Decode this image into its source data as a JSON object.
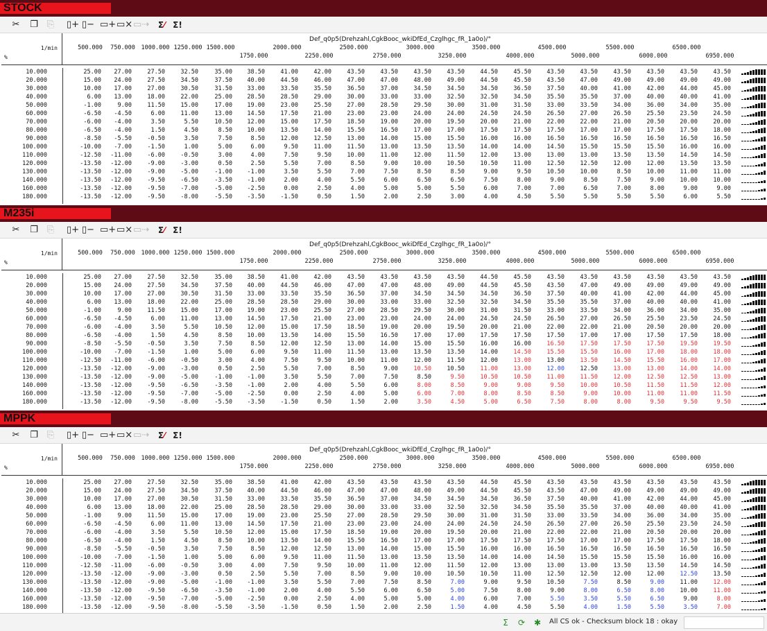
{
  "panels": [
    {
      "title": "STOCK",
      "mode": "base"
    },
    {
      "title": "M235i",
      "mode": "m235"
    },
    {
      "title": "MPPK",
      "mode": "mppk"
    }
  ],
  "toolbar": {
    "icons": [
      "cut-icon",
      "copy-icon",
      "paste-icon",
      "add-column-icon",
      "remove-column-icon",
      "add-row-icon",
      "remove-row-icon",
      "fill-icon",
      "checksum-error-icon",
      "checksum-icon"
    ],
    "sigma_label": "Σ"
  },
  "table": {
    "axis_name": "Def_q0p5(Drehzahl,CgkBooc_wkiDfEd_Czglhgc_fR_1a0o)/°",
    "row_unit": "1/min",
    "row_axis_label": "%",
    "columns": [
      "500.000",
      "750.000",
      "1000.000",
      "1250.000",
      "1500.000",
      "1750.000",
      "2000.000",
      "2250.000",
      "2500.000",
      "2750.000",
      "3000.000",
      "3250.000",
      "3500.000",
      "4000.000",
      "4500.000",
      "5000.000",
      "5500.000",
      "6000.000",
      "6500.000",
      "6950.000"
    ],
    "rows": [
      "10.000",
      "20.000",
      "30.000",
      "40.000",
      "50.000",
      "60.000",
      "70.000",
      "80.000",
      "90.000",
      "100.000",
      "110.000",
      "120.000",
      "130.000",
      "140.000",
      "160.000",
      "180.000"
    ],
    "stock": [
      [
        "25.00",
        "27.00",
        "27.50",
        "32.50",
        "35.00",
        "38.50",
        "41.00",
        "42.00",
        "43.50",
        "43.50",
        "43.50",
        "43.50",
        "44.50",
        "45.50",
        "43.50",
        "43.50",
        "43.50",
        "43.50",
        "43.50",
        "43.50"
      ],
      [
        "15.00",
        "24.00",
        "27.50",
        "34.50",
        "37.50",
        "40.00",
        "44.50",
        "46.00",
        "47.00",
        "47.00",
        "48.00",
        "49.00",
        "44.50",
        "45.50",
        "43.50",
        "47.00",
        "49.00",
        "49.00",
        "49.00",
        "49.00"
      ],
      [
        "10.00",
        "17.00",
        "27.00",
        "30.50",
        "31.50",
        "33.00",
        "33.50",
        "35.50",
        "36.50",
        "37.00",
        "34.50",
        "34.50",
        "34.50",
        "36.50",
        "37.50",
        "40.00",
        "41.00",
        "42.00",
        "44.00",
        "45.00"
      ],
      [
        "6.00",
        "13.00",
        "18.00",
        "22.00",
        "25.00",
        "28.50",
        "28.50",
        "29.00",
        "30.00",
        "33.00",
        "33.00",
        "32.50",
        "32.50",
        "34.50",
        "35.50",
        "35.50",
        "37.00",
        "40.00",
        "40.00",
        "41.00"
      ],
      [
        "-1.00",
        "9.00",
        "11.50",
        "15.00",
        "17.00",
        "19.00",
        "23.00",
        "25.50",
        "27.00",
        "28.50",
        "29.50",
        "30.00",
        "31.00",
        "31.50",
        "33.00",
        "33.50",
        "34.00",
        "36.00",
        "34.00",
        "35.00"
      ],
      [
        "-6.50",
        "-4.50",
        "6.00",
        "11.00",
        "13.00",
        "14.50",
        "17.50",
        "21.00",
        "23.00",
        "23.00",
        "24.00",
        "24.00",
        "24.50",
        "24.50",
        "26.50",
        "27.00",
        "26.50",
        "25.50",
        "23.50",
        "24.50"
      ],
      [
        "-6.00",
        "-4.00",
        "3.50",
        "5.50",
        "10.50",
        "12.00",
        "15.00",
        "17.50",
        "18.50",
        "19.00",
        "20.00",
        "19.50",
        "20.00",
        "21.00",
        "22.00",
        "22.00",
        "21.00",
        "20.50",
        "20.00",
        "20.00"
      ],
      [
        "-6.50",
        "-4.00",
        "1.50",
        "4.50",
        "8.50",
        "10.00",
        "13.50",
        "14.00",
        "15.50",
        "16.50",
        "17.00",
        "17.00",
        "17.50",
        "17.50",
        "17.50",
        "17.00",
        "17.00",
        "17.50",
        "17.50",
        "18.00"
      ],
      [
        "-8.50",
        "-5.50",
        "-0.50",
        "3.50",
        "7.50",
        "8.50",
        "12.00",
        "12.50",
        "13.00",
        "14.00",
        "15.00",
        "15.50",
        "16.00",
        "16.00",
        "16.50",
        "16.50",
        "16.50",
        "16.50",
        "16.50",
        "16.50"
      ],
      [
        "-10.00",
        "-7.00",
        "-1.50",
        "1.00",
        "5.00",
        "6.00",
        "9.50",
        "11.00",
        "11.50",
        "13.00",
        "13.50",
        "13.50",
        "14.00",
        "14.00",
        "14.50",
        "15.50",
        "15.50",
        "15.50",
        "16.00",
        "16.00"
      ],
      [
        "-12.50",
        "-11.00",
        "-6.00",
        "-0.50",
        "3.00",
        "4.00",
        "7.50",
        "9.50",
        "10.00",
        "11.00",
        "12.00",
        "11.50",
        "12.00",
        "13.00",
        "13.00",
        "13.00",
        "13.50",
        "13.50",
        "14.50",
        "14.50"
      ],
      [
        "-13.50",
        "-12.00",
        "-9.00",
        "-3.00",
        "0.50",
        "2.50",
        "5.50",
        "7.00",
        "8.50",
        "9.00",
        "10.00",
        "10.50",
        "10.50",
        "11.00",
        "12.50",
        "12.50",
        "12.00",
        "12.00",
        "13.50",
        "13.50"
      ],
      [
        "-13.50",
        "-12.00",
        "-9.00",
        "-5.00",
        "-1.00",
        "-1.00",
        "3.50",
        "5.50",
        "7.00",
        "7.50",
        "8.50",
        "8.50",
        "9.00",
        "9.50",
        "10.50",
        "10.00",
        "8.50",
        "10.00",
        "11.00",
        "11.00"
      ],
      [
        "-13.50",
        "-12.00",
        "-9.50",
        "-6.50",
        "-3.50",
        "-1.00",
        "2.00",
        "4.00",
        "5.50",
        "6.00",
        "6.50",
        "6.50",
        "7.50",
        "8.00",
        "9.00",
        "8.50",
        "7.50",
        "9.00",
        "10.00",
        "10.00"
      ],
      [
        "-13.50",
        "-12.00",
        "-9.50",
        "-7.00",
        "-5.00",
        "-2.50",
        "0.00",
        "2.50",
        "4.00",
        "5.00",
        "5.00",
        "5.50",
        "6.00",
        "7.00",
        "7.00",
        "6.50",
        "7.00",
        "8.00",
        "9.00",
        "9.00"
      ],
      [
        "-13.50",
        "-12.00",
        "-9.50",
        "-8.00",
        "-5.50",
        "-3.50",
        "-1.50",
        "0.50",
        "1.50",
        "2.00",
        "2.50",
        "3.00",
        "4.00",
        "4.50",
        "5.50",
        "5.50",
        "5.50",
        "5.50",
        "6.00",
        "5.50"
      ]
    ],
    "m235_mods": {
      "8": {
        "14": [
          "16.50",
          "r"
        ],
        "15": [
          "17.50",
          "r"
        ],
        "16": [
          "17.50",
          "r"
        ],
        "17": [
          "17.50",
          "r"
        ],
        "18": [
          "19.50",
          "r"
        ],
        "19": [
          "19.50",
          "r"
        ]
      },
      "9": {
        "13": [
          "14.50",
          "r"
        ],
        "14": [
          "15.50",
          "r"
        ],
        "15": [
          "15.50",
          "r"
        ],
        "16": [
          "16.00",
          "r"
        ],
        "17": [
          "17.00",
          "r"
        ],
        "18": [
          "18.00",
          "r"
        ],
        "19": [
          "18.00",
          "r"
        ]
      },
      "10": {
        "13": [
          "13.00",
          "r"
        ],
        "14": [
          "13.00",
          ""
        ],
        "15": [
          "13.50",
          "r"
        ],
        "16": [
          "14.50",
          "r"
        ],
        "17": [
          "15.50",
          "r"
        ],
        "18": [
          "16.00",
          "r"
        ],
        "19": [
          "17.00",
          "r"
        ]
      },
      "11": {
        "10": [
          "10.50",
          "r"
        ],
        "11": [
          "10.50",
          ""
        ],
        "12": [
          "11.00",
          "r"
        ],
        "13": [
          "13.00",
          "r"
        ],
        "14": [
          "12.00",
          "b"
        ],
        "15": [
          "12.50",
          ""
        ],
        "16": [
          "13.00",
          "r"
        ],
        "17": [
          "13.00",
          "r"
        ],
        "18": [
          "14.00",
          "r"
        ],
        "19": [
          "14.00",
          "r"
        ]
      },
      "12": {
        "11": [
          "9.50",
          "r"
        ],
        "12": [
          "10.50",
          "r"
        ],
        "13": [
          "10.50",
          "r"
        ],
        "14": [
          "11.00",
          "r"
        ],
        "15": [
          "11.50",
          "r"
        ],
        "16": [
          "12.00",
          "r"
        ],
        "17": [
          "12.50",
          "r"
        ],
        "18": [
          "12.50",
          "r"
        ],
        "19": [
          "13.00",
          "r"
        ]
      },
      "13": {
        "10": [
          "8.00",
          "r"
        ],
        "11": [
          "8.50",
          "r"
        ],
        "12": [
          "9.00",
          "r"
        ],
        "13": [
          "9.00",
          "r"
        ],
        "14": [
          "9.50",
          "r"
        ],
        "15": [
          "10.00",
          "r"
        ],
        "16": [
          "10.50",
          "r"
        ],
        "17": [
          "11.50",
          "r"
        ],
        "18": [
          "11.50",
          "r"
        ],
        "19": [
          "12.00",
          "r"
        ]
      },
      "14": {
        "10": [
          "6.00",
          "r"
        ],
        "11": [
          "7.00",
          "r"
        ],
        "12": [
          "8.00",
          "r"
        ],
        "13": [
          "8.50",
          "r"
        ],
        "14": [
          "8.50",
          "r"
        ],
        "15": [
          "9.00",
          "r"
        ],
        "16": [
          "10.00",
          "r"
        ],
        "17": [
          "11.00",
          "r"
        ],
        "18": [
          "11.00",
          "r"
        ],
        "19": [
          "11.50",
          "r"
        ]
      },
      "15": {
        "10": [
          "3.50",
          "r"
        ],
        "11": [
          "4.50",
          "r"
        ],
        "12": [
          "5.00",
          "r"
        ],
        "13": [
          "6.50",
          "r"
        ],
        "14": [
          "7.50",
          "r"
        ],
        "15": [
          "8.00",
          "r"
        ],
        "16": [
          "8.00",
          "r"
        ],
        "17": [
          "9.50",
          "r"
        ],
        "18": [
          "9.50",
          "r"
        ],
        "19": [
          "9.50",
          "r"
        ]
      }
    },
    "mppk_mods": {
      "11": {
        "18": [
          "12.50",
          "b"
        ]
      },
      "12": {
        "11": [
          "7.00",
          "b"
        ],
        "15": [
          "7.50",
          "b"
        ],
        "17": [
          "9.00",
          "b"
        ],
        "19": [
          "12.00",
          "r"
        ]
      },
      "13": {
        "11": [
          "5.00",
          "b"
        ],
        "15": [
          "8.00",
          "b"
        ],
        "16": [
          "6.50",
          "b"
        ],
        "17": [
          "8.00",
          "b"
        ],
        "19": [
          "11.00",
          "r"
        ]
      },
      "14": {
        "11": [
          "4.00",
          "b"
        ],
        "14": [
          "5.50",
          "b"
        ],
        "15": [
          "3.50",
          "b"
        ],
        "16": [
          "5.50",
          "b"
        ],
        "17": [
          "6.50",
          "b"
        ],
        "19": [
          "8.00",
          "r"
        ]
      },
      "15": {
        "11": [
          "1.50",
          "b"
        ],
        "15": [
          "4.00",
          "b"
        ],
        "16": [
          "1.50",
          "b"
        ],
        "17": [
          "5.50",
          "b"
        ],
        "18": [
          "3.50",
          "b"
        ],
        "19": [
          "7.00",
          "r"
        ]
      }
    }
  },
  "statusbar": {
    "text": "All CS ok - Checksum block 18 : okay",
    "icons": [
      "checksum-icon",
      "sync-icon",
      "settings-icon"
    ]
  }
}
